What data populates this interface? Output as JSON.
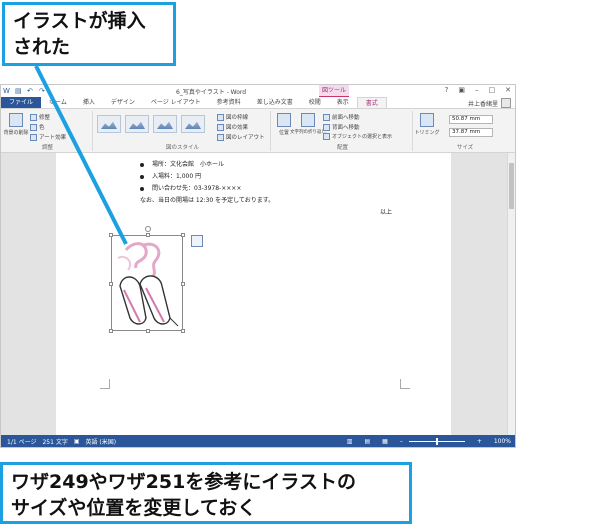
{
  "callouts": {
    "top_line1": "イラストが挿入",
    "top_line2": "された",
    "bottom_line1": "ワザ249やワザ251を参考にイラストの",
    "bottom_line2": "サイズや位置を変更しておく"
  },
  "window": {
    "title": "6_写真やイラスト - Word",
    "context_tab_group": "図ツール",
    "help": "?",
    "restore_ribbon": "▣",
    "minimize": "–",
    "maximize": "□",
    "close": "✕"
  },
  "tabs": [
    {
      "label": "ファイル"
    },
    {
      "label": "ホーム"
    },
    {
      "label": "挿入"
    },
    {
      "label": "デザイン"
    },
    {
      "label": "ページ レイアウト"
    },
    {
      "label": "参考資料"
    },
    {
      "label": "差し込み文書"
    },
    {
      "label": "校閲"
    },
    {
      "label": "表示"
    },
    {
      "label": "書式"
    }
  ],
  "user_name": "井上香緒里",
  "ribbon": {
    "adjust_group_label": "調整",
    "remove_background": "背景の削除",
    "corrections": "修整",
    "color": "色",
    "artistic_effects": "アート効果",
    "picture_styles_label": "図のスタイル",
    "picture_border": "図の枠線",
    "picture_effects": "図の効果",
    "picture_layout": "図のレイアウト",
    "arrange_group_label": "配置",
    "position": "位置",
    "wrap_text": "文字列の折り返し",
    "bring_forward": "前面へ移動",
    "send_backward": "背面へ移動",
    "selection_pane": "オブジェクトの選択と表示",
    "size_group_label": "サイズ",
    "crop": "トリミング",
    "height": "50.87 mm",
    "width": "37.87 mm"
  },
  "document": {
    "line_location": "場所：文化会館　小ホール",
    "line_fee": "入場料：1,000 円",
    "line_contact": "問い合わせ先：03-3978-××××",
    "line_note": "なお、当日の開場は 12:30 を予定しております。",
    "closing": "以上"
  },
  "status": {
    "page": "1/1 ページ",
    "words": "251 文字",
    "language": "英語 (米国)",
    "zoom": "100%"
  }
}
